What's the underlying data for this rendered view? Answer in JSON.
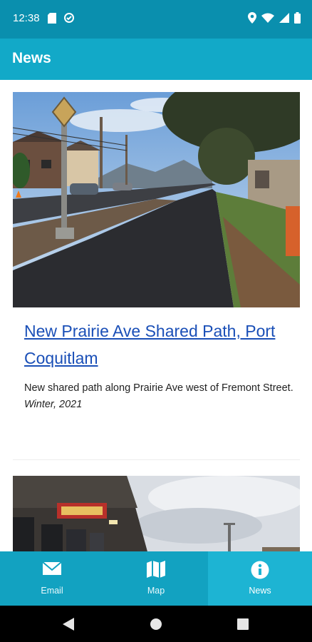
{
  "status": {
    "time": "12:38",
    "left_icons": [
      "sim-card-icon",
      "data-saver-icon"
    ],
    "right_icons": [
      "location-icon",
      "wifi-icon",
      "signal-icon",
      "battery-icon"
    ]
  },
  "app_bar": {
    "title": "News"
  },
  "articles": [
    {
      "image": "shared-path-photo",
      "title": "New Prairie Ave Shared Path, Port Coquitlam",
      "description": "New shared path along Prairie Ave west of Fremont Street.",
      "date": "Winter, 2021"
    },
    {
      "image": "storefront-photo"
    }
  ],
  "bottom_nav": {
    "items": [
      {
        "label": "Email",
        "icon": "envelope-icon",
        "active": false
      },
      {
        "label": "Map",
        "icon": "map-icon",
        "active": false
      },
      {
        "label": "News",
        "icon": "info-icon",
        "active": true
      }
    ]
  },
  "system_nav": [
    "back-icon",
    "home-icon",
    "recents-icon"
  ],
  "colors": {
    "status_bar": "#0a8fae",
    "app_bar": "#12a9c8",
    "bottom_nav": "#12a2c1",
    "bottom_nav_active": "#1db4d3",
    "link": "#1a4fb7"
  }
}
